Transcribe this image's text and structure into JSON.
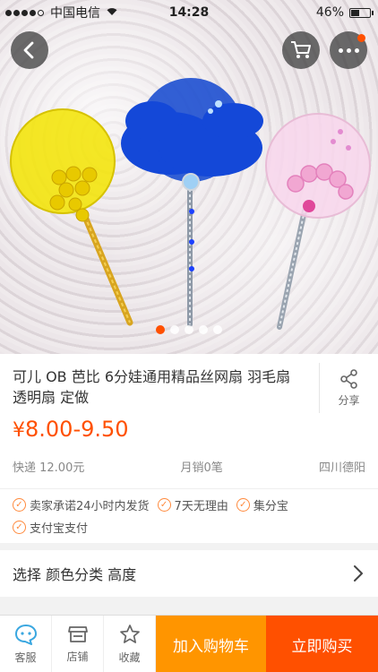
{
  "status_bar": {
    "carrier": "中国电信",
    "time": "14:28",
    "battery": "46%",
    "battery_level": 0.46
  },
  "gallery": {
    "slide_count": 5,
    "active_index": 0
  },
  "product": {
    "title": "可儿 OB  芭比 6分娃通用精品丝网扇 羽毛扇  透明扇 定做",
    "share_label": "分享",
    "price_symbol": "¥",
    "price_low": "8.00",
    "price_sep": "-",
    "price_high": "9.50",
    "shipping": "快递 12.00元",
    "monthly_sales": "月销0笔",
    "location": "四川德阳"
  },
  "promises": [
    "卖家承诺24小时内发货",
    "7天无理由",
    "集分宝",
    "支付宝支付"
  ],
  "select": {
    "label": "选择 颜色分类 高度"
  },
  "bottom_bar": {
    "service_label": "客服",
    "shop_label": "店铺",
    "favorite_label": "收藏",
    "add_to_cart_label": "加入购物车",
    "buy_now_label": "立即购买"
  },
  "colors": {
    "accent": "#ff5000",
    "cart_button": "#ff9500",
    "service_icon": "#3aa7e0"
  }
}
